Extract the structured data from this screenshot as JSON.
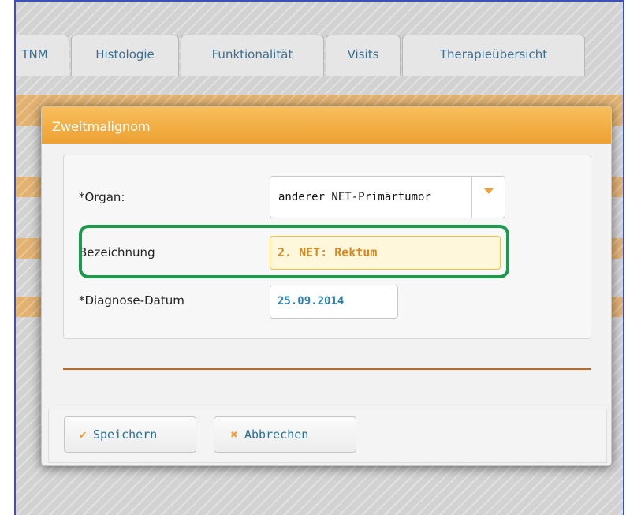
{
  "tabs": [
    {
      "label": "TNM"
    },
    {
      "label": "Histologie"
    },
    {
      "label": "Funktionalität"
    },
    {
      "label": "Visits"
    },
    {
      "label": "Therapieübersicht"
    }
  ],
  "dialog": {
    "title": "Zweitmalignom",
    "fields": {
      "organ": {
        "label": "*Organ:",
        "value": "anderer NET-Primärtumor"
      },
      "bezeichnung": {
        "label": "Bezeichnung",
        "value": "2. NET: Rektum"
      },
      "diagnose_datum": {
        "label": "*Diagnose-Datum",
        "value": "25.09.2014"
      }
    },
    "buttons": {
      "save": {
        "label": "Speichern",
        "icon": "checkmark-icon"
      },
      "cancel": {
        "label": "Abbrechen",
        "icon": "x-icon"
      }
    }
  },
  "colors": {
    "accent": "#eda133",
    "highlight": "#1a9a4a",
    "link": "#2a6f9a"
  }
}
